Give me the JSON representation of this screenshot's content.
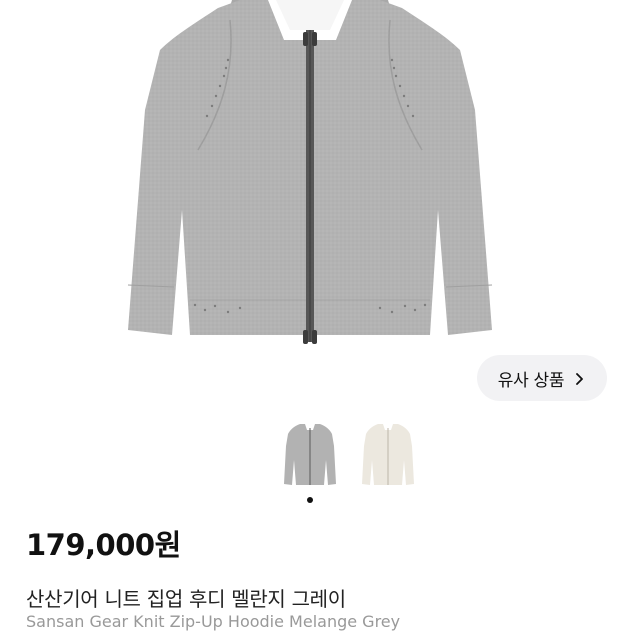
{
  "product": {
    "image_icon": "gray-knit-zip-up-hoodie",
    "colors": {
      "garment_main": "#b1b1b1",
      "garment_shade": "#a3a3a3",
      "zipper": "#4a4a4a",
      "ivory_garment": "#eeeae2"
    },
    "thumbnails": [
      {
        "variant": "gray",
        "selected": true
      },
      {
        "variant": "ivory",
        "selected": false
      }
    ],
    "price": "179,000원",
    "title": "산산기어 니트 집업 후디 멜란지 그레이",
    "subtitle": "Sansan Gear Knit Zip-Up Hoodie Melange Grey"
  },
  "similar_button": {
    "label": "유사 상품",
    "icon": "chevron-right-icon"
  },
  "carousel": {
    "current_index": 1,
    "total": 2
  }
}
